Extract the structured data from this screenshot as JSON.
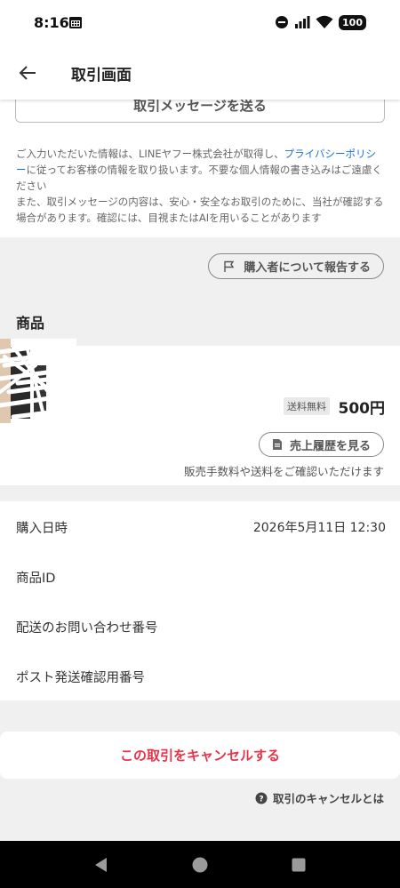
{
  "status_bar": {
    "time": "8:16",
    "battery": "100"
  },
  "header": {
    "title": "取引画面"
  },
  "send_message_button": "取引メッセージを送る",
  "privacy": {
    "before_link": "ご入力いただいた情報は、LINEヤフー株式会社が取得し、",
    "link": "プライバシーポリシー",
    "after_link": "に従ってお客様の情報を取り扱います。不要な個人情報の書き込みはご遠慮ください",
    "second": "また、取引メッセージの内容は、安心・安全なお取引のために、当社が確認する場合があります。確認には、目視またはAIを用いることがあります"
  },
  "report_button": "購入者について報告する",
  "product_section": {
    "title": "商品",
    "shipping_free": "送料無料",
    "price": "500円",
    "sales_history_button": "売上履歴を見る",
    "fee_note": "販売手数料や送料をご確認いただけます"
  },
  "info": [
    {
      "label": "購入日時",
      "value": "2026年5月11日 12:30"
    },
    {
      "label": "商品ID",
      "value": ""
    },
    {
      "label": "配送のお問い合わせ番号",
      "value": ""
    },
    {
      "label": "ポスト発送確認用番号",
      "value": ""
    }
  ],
  "cancel_button": "この取引をキャンセルする",
  "cancel_help": "取引のキャンセルとは",
  "colors": {
    "accent_red": "#e8334a",
    "link_blue": "#1a6fd4"
  },
  "icons": [
    "calendar-icon",
    "dnd-icon",
    "signal-icon",
    "wifi-icon",
    "back-arrow-icon",
    "flag-icon",
    "document-icon",
    "help-circle-icon",
    "nav-back-icon",
    "nav-home-icon",
    "nav-recents-icon"
  ]
}
